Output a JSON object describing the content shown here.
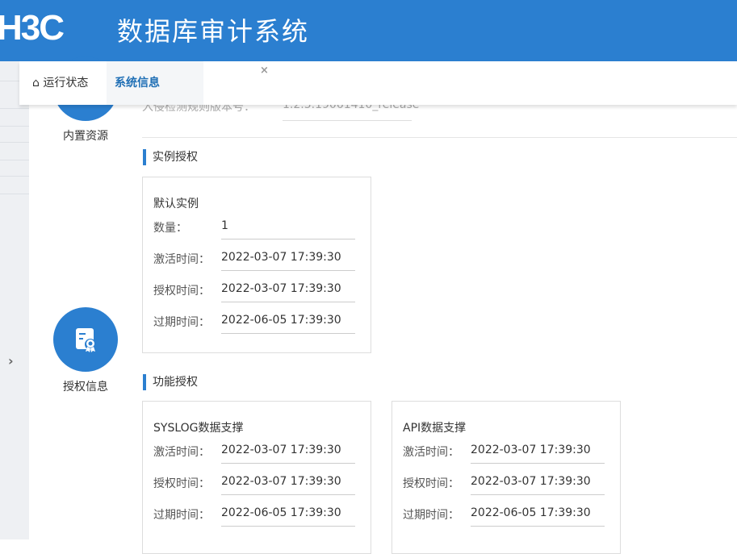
{
  "header": {
    "logo": "H3C",
    "title": "数据库审计系统"
  },
  "tabs": [
    {
      "label": "运行状态",
      "icon": "home-icon"
    },
    {
      "label": "系统信息",
      "close": "×"
    }
  ],
  "side": {
    "builtin": "内置资源",
    "license": "授权信息"
  },
  "version": {
    "label": "入侵检测规则版本号：",
    "value": "1.2.5.19061410_release"
  },
  "instance_section": {
    "title": "实例授权",
    "card": {
      "name": "默认实例",
      "rows": [
        {
          "k": "数量：",
          "v": "1"
        },
        {
          "k": "激活时间：",
          "v": "2022-03-07 17:39:30"
        },
        {
          "k": "授权时间：",
          "v": "2022-03-07 17:39:30"
        },
        {
          "k": "过期时间：",
          "v": "2022-06-05 17:39:30"
        }
      ]
    }
  },
  "feature_section": {
    "title": "功能授权",
    "cards": [
      {
        "name": "SYSLOG数据支撑",
        "rows": [
          {
            "k": "激活时间：",
            "v": "2022-03-07 17:39:30"
          },
          {
            "k": "授权时间：",
            "v": "2022-03-07 17:39:30"
          },
          {
            "k": "过期时间：",
            "v": "2022-06-05 17:39:30"
          }
        ]
      },
      {
        "name": "API数据支撑",
        "rows": [
          {
            "k": "激活时间：",
            "v": "2022-03-07 17:39:30"
          },
          {
            "k": "授权时间：",
            "v": "2022-03-07 17:39:30"
          },
          {
            "k": "过期时间：",
            "v": "2022-06-05 17:39:30"
          }
        ]
      }
    ]
  }
}
